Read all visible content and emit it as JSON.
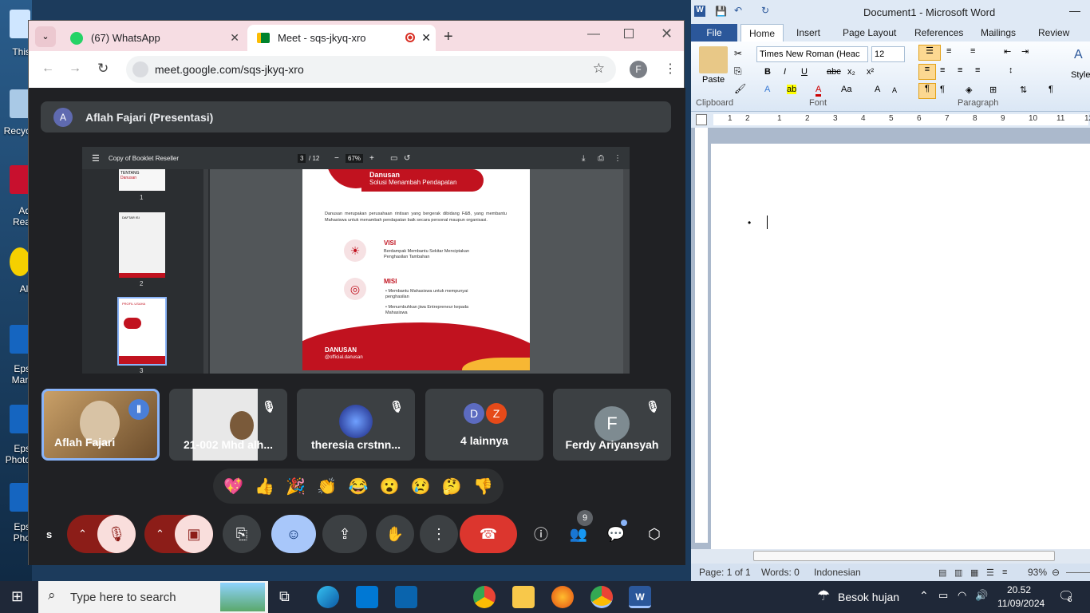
{
  "desktop": {
    "icons": [
      "This",
      "Recyc",
      "Ad Rea",
      "All",
      "Eps Man",
      "Eps Photo",
      "Eps Pho"
    ]
  },
  "chrome": {
    "tabs": [
      {
        "title": "(67) WhatsApp"
      },
      {
        "title": "Meet - sqs-jkyq-xro"
      }
    ],
    "url": "meet.google.com/sqs-jkyq-xro",
    "profile_initial": "F"
  },
  "meet": {
    "presenter_initial": "A",
    "presenter_label": "Aflah Fajari (Presentasi)",
    "pdf": {
      "filename": "Copy of Booklet Reseller",
      "page_current": "3",
      "page_total": "/ 12",
      "zoom": "67%",
      "thumb_numbers": [
        "1",
        "2",
        "3"
      ],
      "thumb_text": {
        "t1_title": "TENTANG",
        "t1_brand": "Danusan",
        "t2_title": "DAFTAR ISI",
        "t3_title": "PROFIL USAHA"
      },
      "page": {
        "brand": "Danusan",
        "tagline": "Solusi Menambah Pendapatan",
        "intro": "Danusan merupakan perusahaan rintisan yang bergerak dibidang F&B, yang membantu Mahasiswa untuk menambah pendapatan baik secara personal maupun organisasi.",
        "visi_title": "VISI",
        "visi_text": "Berdampak Membantu Sekitar Menciptakan Penghasilan Tambahan",
        "misi_title": "MISI",
        "misi_items": [
          "Membantu Mahasiswa untuk mempunyai penghasilan",
          "Menumbuhkan jiwa Entrepreneur kepada Mahasiswa"
        ],
        "footer_brand": "DANUSAN",
        "footer_handle": "@official.danusan"
      }
    },
    "participants": [
      {
        "name": "Aflah Fajari"
      },
      {
        "name": "21-002 Mhd alh..."
      },
      {
        "name": "theresia crstnn..."
      },
      {
        "name": "4 lainnya",
        "initials": [
          "D",
          "Z"
        ]
      },
      {
        "name": "Ferdy Ariyansyah",
        "initial": "F"
      }
    ],
    "reactions": [
      "💖",
      "👍",
      "🎉",
      "👏",
      "😂",
      "😮",
      "😢",
      "🤔",
      "👎"
    ],
    "controls": {
      "left_label": "s",
      "people_badge": "9"
    }
  },
  "word": {
    "title": "Document1 - Microsoft Word",
    "tabs": [
      "File",
      "Home",
      "Insert",
      "Page Layout",
      "References",
      "Mailings",
      "Review"
    ],
    "font_name": "Times New Roman (Heac",
    "font_size": "12",
    "groups": {
      "clipboard": "Clipboard",
      "font": "Font",
      "paragraph": "Paragraph",
      "styles": "Style"
    },
    "paste_label": "Paste",
    "ruler_numbers": [
      "1",
      "2",
      "1",
      "2",
      "3",
      "4",
      "5",
      "6",
      "7",
      "8",
      "9",
      "10",
      "11",
      "12"
    ],
    "status": {
      "page": "Page: 1 of 1",
      "words": "Words: 0",
      "language": "Indonesian",
      "zoom": "93%"
    }
  },
  "taskbar": {
    "search_placeholder": "Type here to search",
    "weather": "Besok hujan",
    "time": "20.52",
    "date": "11/09/2024",
    "notification_count": "6"
  }
}
